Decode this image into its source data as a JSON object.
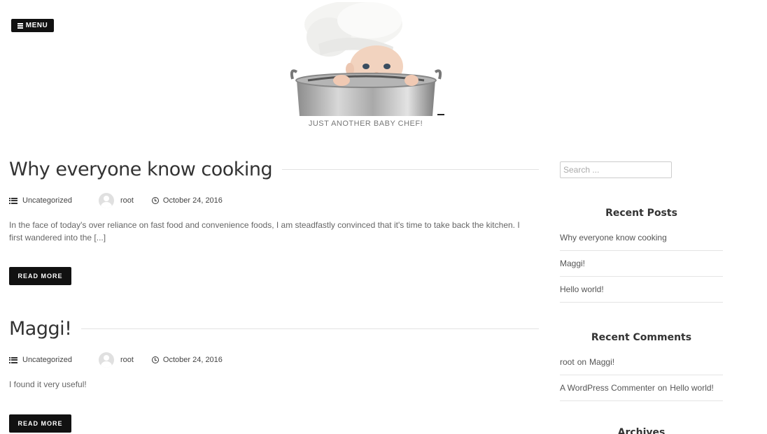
{
  "header": {
    "menu_label": "MENU",
    "tagline": "JUST ANOTHER BABY CHEF!"
  },
  "posts": [
    {
      "title": "Why everyone know cooking",
      "category": "Uncategorized",
      "author": "root",
      "date": "October 24, 2016",
      "excerpt": "In the face of today's over reliance on fast food and convenience foods, I am steadfastly convinced that it's time to take back the kitchen. I first wandered into the [...]",
      "read_more": "READ MORE"
    },
    {
      "title": "Maggi!",
      "category": "Uncategorized",
      "author": "root",
      "date": "October 24, 2016",
      "excerpt": "I found it very useful!",
      "read_more": "READ MORE"
    }
  ],
  "sidebar": {
    "search_placeholder": "Search ...",
    "recent_posts_title": "Recent Posts",
    "recent_posts": [
      "Why everyone know cooking",
      "Maggi!",
      "Hello world!"
    ],
    "recent_comments_title": "Recent Comments",
    "recent_comments": [
      {
        "author": "root",
        "on": "on",
        "post": "Maggi!"
      },
      {
        "author": "A WordPress Commenter",
        "on": "on",
        "post": "Hello world!"
      }
    ],
    "archives_title": "Archives"
  }
}
